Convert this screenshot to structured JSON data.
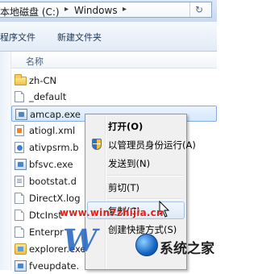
{
  "address_bar": {
    "segments": [
      "本地磁盘 (C:)",
      "Windows"
    ],
    "refresh_icon": "refresh-icon"
  },
  "toolbar": {
    "buttons": [
      "程序文件",
      "新建文件夹"
    ]
  },
  "file_list": {
    "column_header": "名称",
    "rows": [
      {
        "name": "zh-CN",
        "icon": "folder-icon"
      },
      {
        "name": "_default",
        "icon": "file-icon"
      },
      {
        "name": "amcap.exe",
        "icon": "exe-icon",
        "selected": true
      },
      {
        "name": "atiogl.xml",
        "icon": "xml-file-icon"
      },
      {
        "name": "ativpsrm.b",
        "icon": "file-icon"
      },
      {
        "name": "bfsvc.exe",
        "icon": "exe-icon"
      },
      {
        "name": "bootstat.d",
        "icon": "dat-file-icon"
      },
      {
        "name": "DirectX.log",
        "icon": "file-icon"
      },
      {
        "name": "DtcInst",
        "icon": "file-icon"
      },
      {
        "name": "Enterpr",
        "icon": "file-icon"
      },
      {
        "name": "explorer.exe",
        "icon": "explorer-icon"
      },
      {
        "name": "fveupdate.",
        "icon": "exe-icon"
      }
    ]
  },
  "context_menu": {
    "items": [
      {
        "label": "打开(O)",
        "bold": true
      },
      {
        "label": "以管理员身份运行(A)",
        "icon": "uac-shield-icon"
      },
      {
        "label": "发送到(N)"
      },
      {
        "separator": true
      },
      {
        "label": "剪切(T)"
      },
      {
        "separator": true
      },
      {
        "label": "复制(C)",
        "hover": true
      },
      {
        "label": "创建快捷方式(S)"
      }
    ]
  },
  "watermark": {
    "url": "www.win7zhijia.cn",
    "brand": "系统之家",
    "logo_letter": "W"
  },
  "colors": {
    "selection_fill": "#d6e8fb",
    "selection_border": "#84acdd",
    "watermark_red": "#e0221b",
    "watermark_blue": "#1f63c0"
  }
}
